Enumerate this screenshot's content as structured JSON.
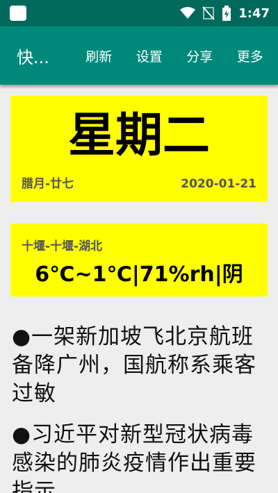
{
  "status_bar": {
    "time": "1:47",
    "icons": [
      "notification-icon",
      "wifi-icon",
      "no-signal-icon",
      "battery-icon"
    ]
  },
  "app_bar": {
    "title": "快...",
    "menu": [
      "刷新",
      "设置",
      "分享",
      "更多"
    ]
  },
  "day_card": {
    "weekday": "星期二",
    "lunar": "腊月-廿七",
    "date": "2020-01-21"
  },
  "weather_card": {
    "location": "十堰-十堰-湖北",
    "summary": "6℃~1℃|71%rh|阴"
  },
  "news": [
    "●一架新加坡飞北京航班备降广州，国航称系乘客过敏",
    "●习近平对新型冠状病毒感染的肺炎疫情作出重要指示"
  ],
  "colors": {
    "status_bar": "#00695c",
    "app_bar": "#00897b",
    "card": "#ffff00",
    "background": "#eeeeee"
  }
}
